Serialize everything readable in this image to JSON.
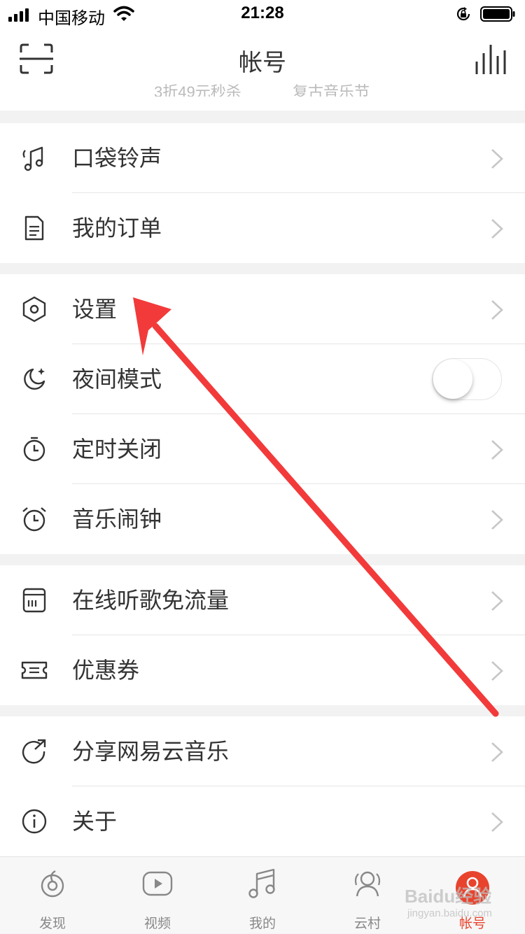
{
  "status_bar": {
    "carrier": "中国移动",
    "time": "21:28"
  },
  "header": {
    "title": "帐号",
    "clipped_left": "3折49元秒杀",
    "clipped_right": "复古音乐节"
  },
  "groups": [
    [
      {
        "label": "口袋铃声",
        "icon": "ringtone-icon"
      },
      {
        "label": "我的订单",
        "icon": "order-icon"
      }
    ],
    [
      {
        "label": "设置",
        "icon": "settings-icon"
      },
      {
        "label": "夜间模式",
        "icon": "night-mode-icon",
        "toggle": false
      },
      {
        "label": "定时关闭",
        "icon": "timer-icon"
      },
      {
        "label": "音乐闹钟",
        "icon": "alarm-icon"
      }
    ],
    [
      {
        "label": "在线听歌免流量",
        "icon": "data-free-icon"
      },
      {
        "label": "优惠券",
        "icon": "coupon-icon"
      }
    ],
    [
      {
        "label": "分享网易云音乐",
        "icon": "share-icon"
      },
      {
        "label": "关于",
        "icon": "info-icon"
      }
    ]
  ],
  "tabs": [
    {
      "label": "发现",
      "icon": "discover-icon",
      "active": false
    },
    {
      "label": "视频",
      "icon": "video-icon",
      "active": false
    },
    {
      "label": "我的",
      "icon": "music-note-icon",
      "active": false
    },
    {
      "label": "云村",
      "icon": "community-icon",
      "active": false
    },
    {
      "label": "帐号",
      "icon": "account-icon",
      "active": true
    }
  ],
  "colors": {
    "accent": "#e8432d",
    "annotation_arrow": "#f23a3a"
  },
  "watermark": {
    "main": "Baidu经验",
    "sub": "jingyan.baidu.com"
  }
}
